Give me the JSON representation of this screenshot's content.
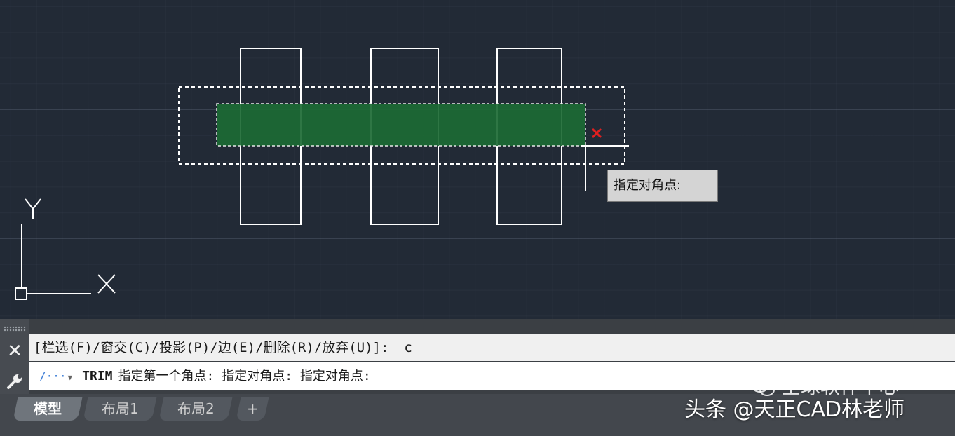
{
  "tooltip": {
    "text": "指定对角点:"
  },
  "ucs": {
    "x_label": "X",
    "y_label": "Y"
  },
  "command_line": {
    "history_text": "[栏选(F)/窗交(C)/投影(P)/边(E)/删除(R)/放弃(U)]:",
    "history_entered": "c",
    "command_name": "TRIM",
    "prompt_text": "指定第一个角点: 指定对角点: 指定对角点:"
  },
  "tabs": [
    {
      "label": "模型",
      "active": true
    },
    {
      "label": "布局1",
      "active": false
    },
    {
      "label": "布局2",
      "active": false
    },
    {
      "label": "+",
      "active": false
    }
  ],
  "watermark": {
    "channel": "全球软件中心",
    "signature": "头条 @天正CAD林老师"
  },
  "colors": {
    "background": "#222a36",
    "geometry": "#ffffff",
    "selection_fill": "#1c6a34",
    "close_marker": "#e02020"
  }
}
